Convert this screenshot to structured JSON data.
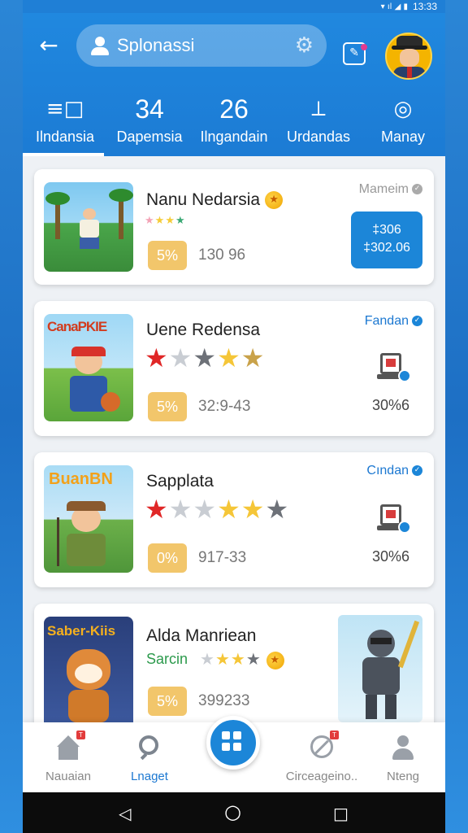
{
  "status_bar": {
    "time": "13:33",
    "icons": "▾ ıl ◢ ▮"
  },
  "header": {
    "back_icon": "back-arrow-icon",
    "search_text": "Splonassi",
    "settings_icon": "gear-icon",
    "edit_icon": "edit-icon",
    "avatar_icon": "avatar"
  },
  "tabs": [
    {
      "top": "≡□",
      "top_type": "icon",
      "label": "Ilndansia",
      "active": true
    },
    {
      "top": "34",
      "top_type": "number",
      "label": "Dapemsia",
      "active": false
    },
    {
      "top": "26",
      "top_type": "number",
      "label": "Ilngandain",
      "active": false
    },
    {
      "top": "⟂",
      "top_type": "icon",
      "label": "Urdandas",
      "active": false
    },
    {
      "top": "◎",
      "top_type": "icon",
      "label": "Manay",
      "active": false
    }
  ],
  "cards": [
    {
      "title": "Nanu Nedarsia",
      "stars": "★★★★",
      "percent": "5%",
      "stat": "130 96",
      "right_tag": "Mameim",
      "price_line1": "‡306",
      "price_line2": "‡302.06"
    },
    {
      "title": "Uene Redensa",
      "stars": "★★★★★",
      "percent": "5%",
      "stat": "32:9-43",
      "right_tag": "Fandan",
      "device_count": "30%6",
      "thumb_text": "CanaPKIE"
    },
    {
      "title": "Sapplata",
      "stars": "★★★★★★",
      "percent": "0%",
      "stat": "917-33",
      "right_tag": "Cından",
      "device_count": "30%6",
      "thumb_text": "BuanBN"
    },
    {
      "title": "Alda Manriean",
      "subtitle": "Sarcin",
      "stars": "★★★★",
      "percent": "5%",
      "stat": "399233",
      "thumb_text": "Saber-Kiis"
    }
  ],
  "bottom_nav": [
    {
      "label": "Nauaian",
      "icon": "home-icon",
      "badge": "T"
    },
    {
      "label": "Lnaget",
      "icon": "search-icon",
      "active": true
    },
    {
      "label": "Circeageino..",
      "icon": "no-entry-icon",
      "badge": "T"
    },
    {
      "label": "Nteng",
      "icon": "person-icon"
    }
  ],
  "android_nav": {
    "back": "◁",
    "home": "○",
    "recents": "□"
  },
  "colors": {
    "primary": "#1c86d8",
    "header": "#2088df",
    "badge": "#f2c66b"
  }
}
